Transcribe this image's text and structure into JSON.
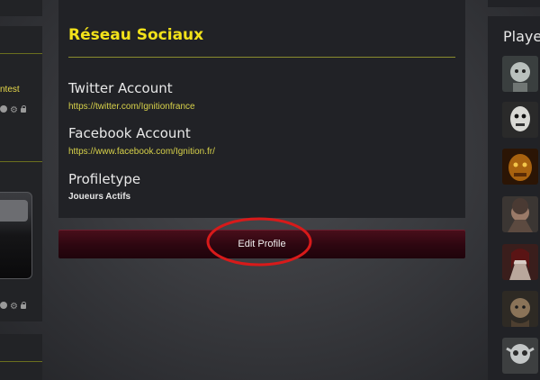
{
  "left_sidebar": {
    "link_fragment": "ntest"
  },
  "profile": {
    "section_title": "Réseau Sociaux",
    "fields": [
      {
        "label": "Twitter Account",
        "value": "https://twitter.com/Ignitionfrance"
      },
      {
        "label": "Facebook Account",
        "value": "https://www.facebook.com/Ignition.fr/"
      },
      {
        "label": "Profiletype",
        "value": "Joueurs Actifs"
      }
    ],
    "edit_button_label": "Edit Profile"
  },
  "right_sidebar": {
    "title": "Playe",
    "avatars": [
      "player-avatar",
      "player-avatar",
      "player-avatar",
      "player-avatar",
      "player-avatar",
      "player-avatar",
      "player-avatar"
    ]
  },
  "colors": {
    "accent_yellow": "#f2e21a",
    "link_yellow": "#d8d24a",
    "button_maroon": "#2d0610",
    "annotation_red": "#d81a1a"
  }
}
